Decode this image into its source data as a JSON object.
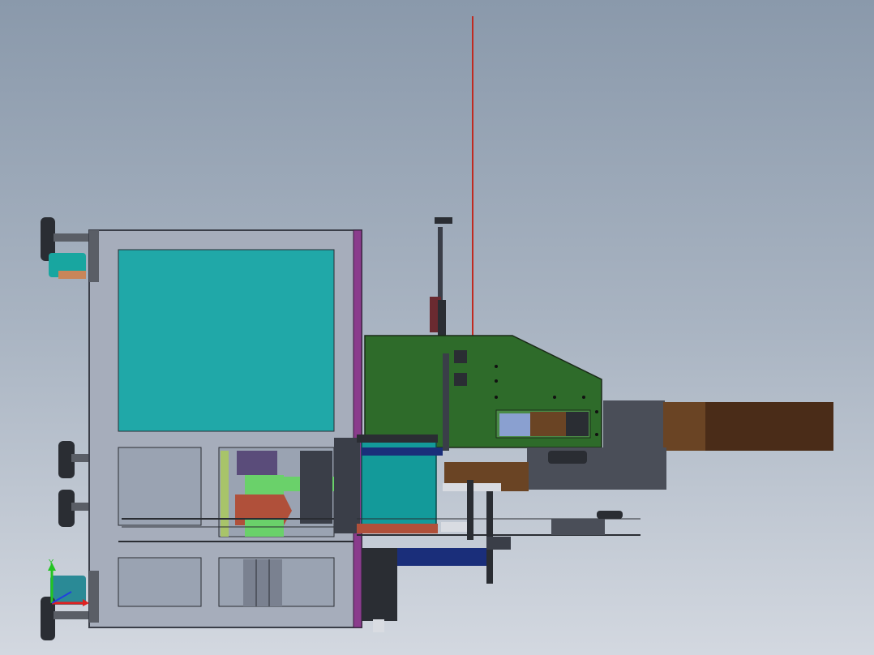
{
  "viewport": {
    "background_top": "#8a99ab",
    "background_bottom": "#d3d8e0"
  },
  "triad": {
    "y_label": "Y",
    "y_color": "#22c422",
    "x_color": "#e02020",
    "z_color": "#2040e0"
  },
  "colors": {
    "frame": "#a6adbb",
    "frame_dark": "#3a3e48",
    "panel": "#20a8a8",
    "purple_plate": "#8a3c8c",
    "green_housing": "#2e6b2a",
    "teal_cylinder": "#139a9a",
    "brown_block": "#6a4424",
    "red_rod": "#c03a2c",
    "navy_base": "#1a2e7a",
    "copper": "#c8865a"
  }
}
